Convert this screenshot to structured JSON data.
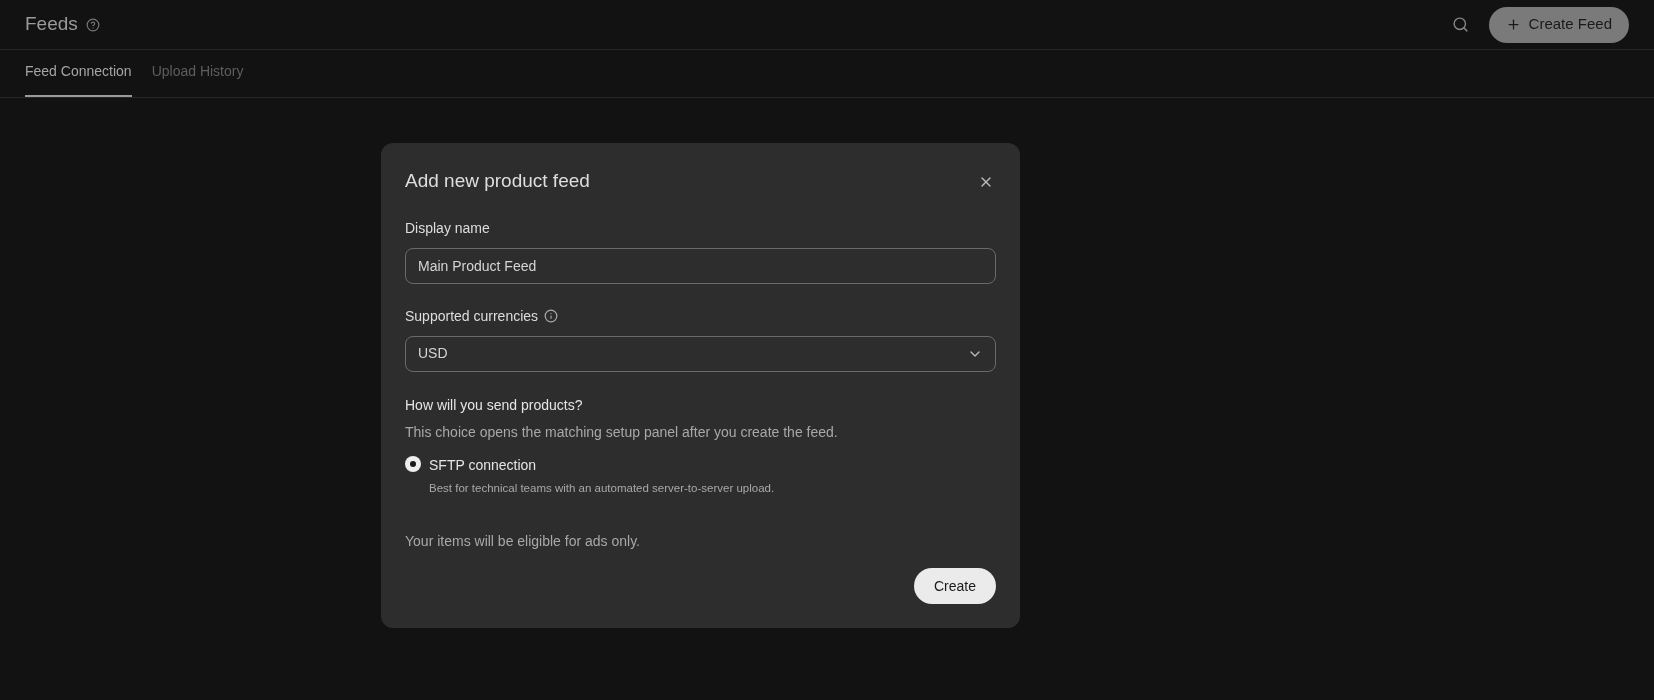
{
  "header": {
    "title": "Feeds",
    "create_button": "Create Feed"
  },
  "tabs": [
    {
      "label": "Feed Connection",
      "selected": true
    },
    {
      "label": "Upload History",
      "selected": false
    }
  ],
  "dialog": {
    "title": "Add new product feed",
    "display_name": {
      "label": "Display name",
      "value": "Main Product Feed"
    },
    "currencies": {
      "label": "Supported currencies",
      "value": "USD"
    },
    "method": {
      "heading": "How will you send products?",
      "description": "This choice opens the matching setup panel after you create the feed.",
      "options": [
        {
          "label": "SFTP connection",
          "description": "Best for technical teams with an automated server-to-server upload.",
          "selected": true
        }
      ]
    },
    "note": "Your items will be eligible for ads only.",
    "submit": "Create"
  }
}
